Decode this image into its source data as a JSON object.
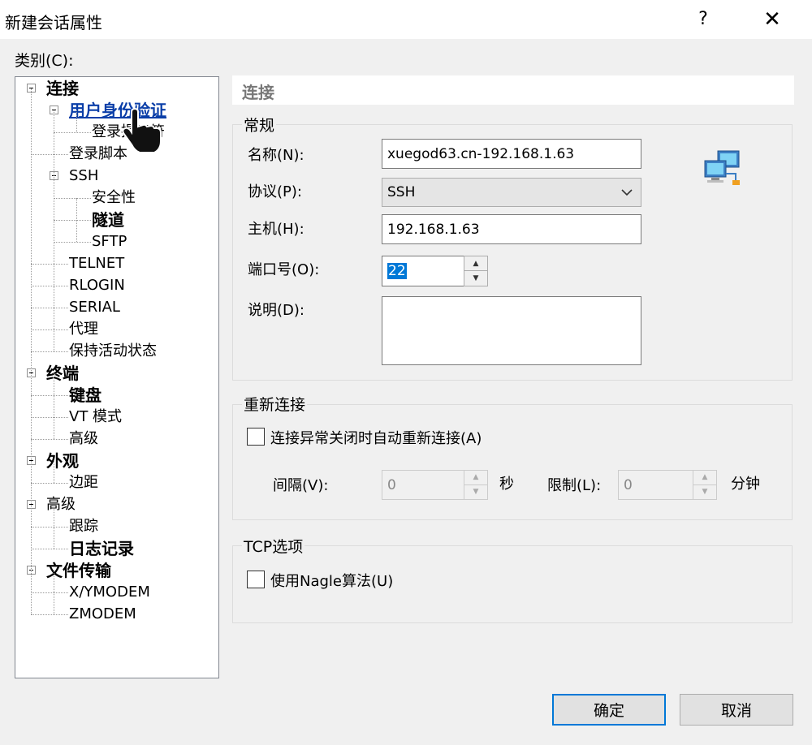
{
  "window": {
    "title": "新建会话属性",
    "help_label": "?",
    "close_label": "✕"
  },
  "category_label": "类别(C):",
  "tree": [
    {
      "label": "连接",
      "style": "bold"
    },
    {
      "label": "用户身份验证",
      "style": "link"
    },
    {
      "label": "登录提示符",
      "style": "normal"
    },
    {
      "label": "登录脚本",
      "style": "normal"
    },
    {
      "label": "SSH",
      "style": "normal"
    },
    {
      "label": "安全性",
      "style": "normal"
    },
    {
      "label": "隧道",
      "style": "bold"
    },
    {
      "label": "SFTP",
      "style": "normal"
    },
    {
      "label": "TELNET",
      "style": "normal"
    },
    {
      "label": "RLOGIN",
      "style": "normal"
    },
    {
      "label": "SERIAL",
      "style": "normal"
    },
    {
      "label": "代理",
      "style": "normal"
    },
    {
      "label": "保持活动状态",
      "style": "normal"
    },
    {
      "label": "终端",
      "style": "bold"
    },
    {
      "label": "键盘",
      "style": "bold"
    },
    {
      "label": "VT 模式",
      "style": "normal"
    },
    {
      "label": "高级",
      "style": "normal"
    },
    {
      "label": "外观",
      "style": "bold"
    },
    {
      "label": "边距",
      "style": "normal"
    },
    {
      "label": "高级",
      "style": "normal"
    },
    {
      "label": "跟踪",
      "style": "normal"
    },
    {
      "label": "日志记录",
      "style": "bold"
    },
    {
      "label": "文件传输",
      "style": "bold"
    },
    {
      "label": "X/YMODEM",
      "style": "normal"
    },
    {
      "label": "ZMODEM",
      "style": "normal"
    }
  ],
  "section_title": "连接",
  "general": {
    "group_title": "常规",
    "name_label": "名称(N):",
    "name_value": "xuegod63.cn-192.168.1.63",
    "protocol_label": "协议(P):",
    "protocol_value": "SSH",
    "host_label": "主机(H):",
    "host_value": "192.168.1.63",
    "port_label": "端口号(O):",
    "port_value": "22",
    "desc_label": "说明(D):",
    "desc_value": ""
  },
  "reconnect": {
    "group_title": "重新连接",
    "checkbox_label": "连接异常关闭时自动重新连接(A)",
    "interval_label": "间隔(V):",
    "interval_value": "0",
    "interval_unit": "秒",
    "limit_label": "限制(L):",
    "limit_value": "0",
    "limit_unit": "分钟"
  },
  "tcp": {
    "group_title": "TCP选项",
    "nagle_label": "使用Nagle算法(U)"
  },
  "buttons": {
    "ok": "确定",
    "cancel": "取消"
  }
}
